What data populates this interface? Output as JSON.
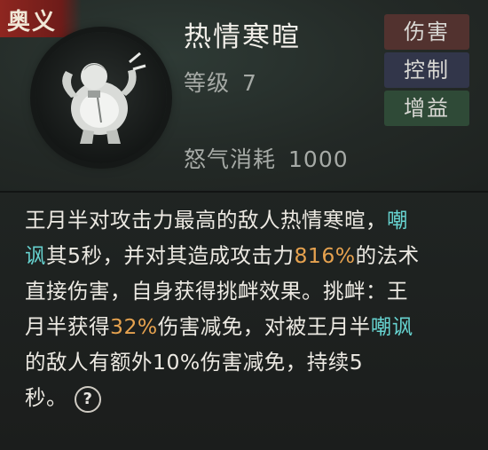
{
  "tag": "奥义",
  "skill": {
    "name": "热情寒暄",
    "level_label": "等级",
    "level": "7",
    "rage_label": "怒气消耗",
    "rage_cost": "1000"
  },
  "badges": [
    "伤害",
    "控制",
    "增益"
  ],
  "description": {
    "l1a": "王月半对攻击力最高的敌人热情寒暄，",
    "l1b": "嘲",
    "l2a": "讽",
    "l2b": "其5秒，并对其造成攻击力",
    "l2c": "816%",
    "l2d": "的法术",
    "l3": "直接伤害，自身获得挑衅效果。挑衅：王",
    "l4a": "月半获得",
    "l4b": "32%",
    "l4c": "伤害减免，对被王月半",
    "l4d": "嘲讽",
    "l5": "的敌人有额外10%伤害减免，持续5",
    "l6": "秒。",
    "help": "?"
  },
  "colors": {
    "keyword": "#66d2cf",
    "number": "#e6a24f",
    "tag_bg": "#8e2620"
  },
  "icons": {
    "portrait": "character-portrait-icon",
    "help": "help-question-icon"
  }
}
